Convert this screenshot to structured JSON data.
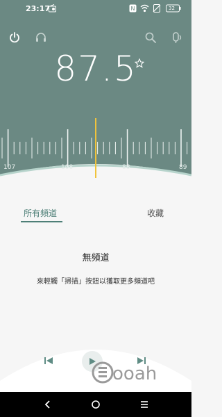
{
  "status_bar": {
    "time": "23:17",
    "battery": "32",
    "icons": [
      "radio-app-icon",
      "nfc-icon",
      "wifi-icon",
      "sim-off-icon",
      "battery-icon"
    ]
  },
  "radio": {
    "frequency": "87.5",
    "favorite_icon": "star-outline-icon",
    "dial_labels": [
      "107",
      "108",
      "88",
      "89"
    ],
    "colors": {
      "header": "#6b8983",
      "needle": "#f0c33c",
      "accent": "#4e7f77"
    }
  },
  "toolbar": {
    "power_icon": "power-icon",
    "headset_icon": "headphones-icon",
    "search_icon": "search-icon",
    "record_icon": "record-icon"
  },
  "tabs": [
    {
      "label": "所有頻道",
      "active": true
    },
    {
      "label": "收藏",
      "active": false
    }
  ],
  "empty_state": {
    "title": "無頻道",
    "hint": "來輕觸「掃描」按鈕以獲取更多頻道吧"
  },
  "controls": {
    "prev_icon": "skip-previous-icon",
    "play_icon": "play-icon",
    "next_icon": "skip-next-icon"
  },
  "watermark_text": "Qooah",
  "nav": {
    "back_icon": "back-icon",
    "home_icon": "home-icon",
    "recent_icon": "menu-icon"
  }
}
